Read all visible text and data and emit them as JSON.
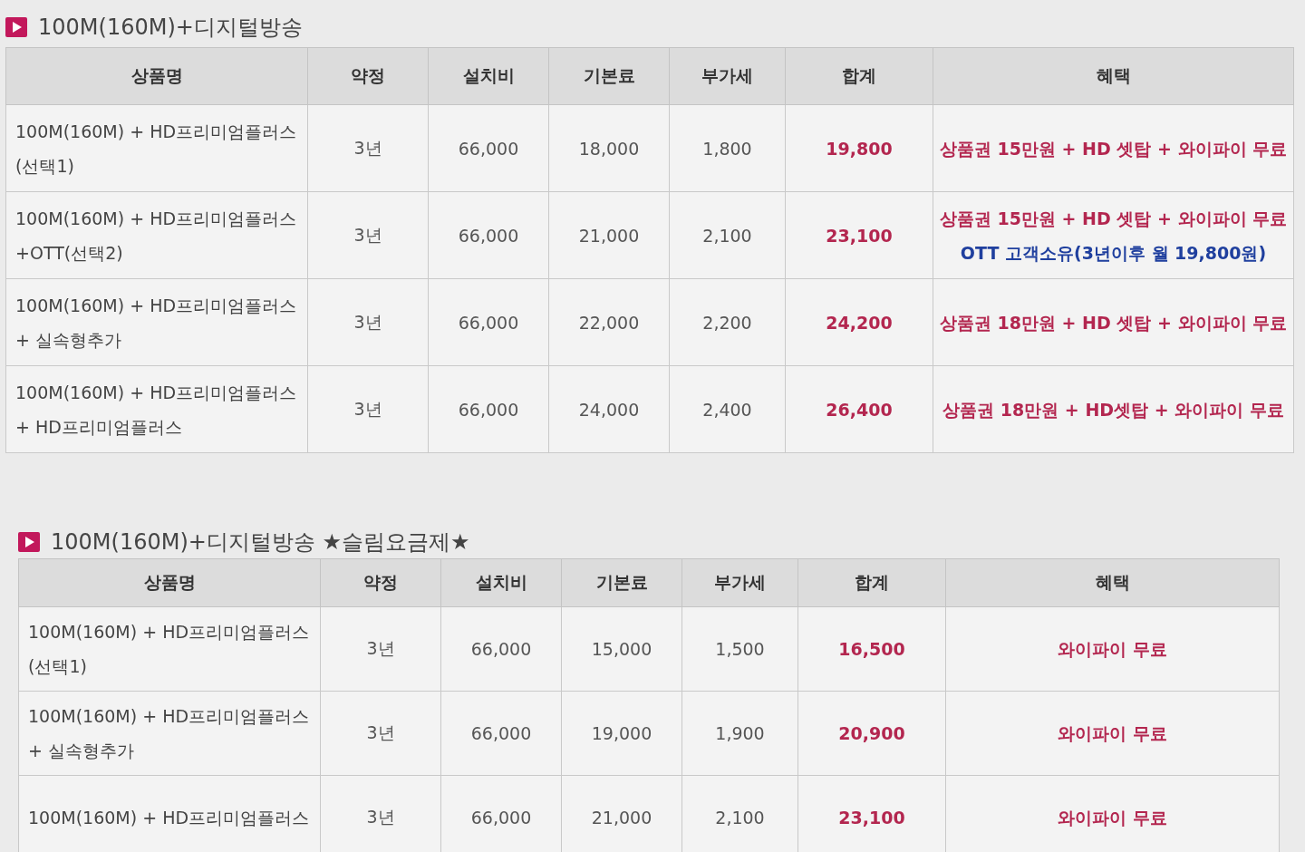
{
  "sections": [
    {
      "title": "100M(160M)+디지털방송",
      "columns": [
        "상품명",
        "약정",
        "설치비",
        "기본료",
        "부가세",
        "합계",
        "혜택"
      ],
      "rows": [
        {
          "name": [
            "100M(160M) + HD프리미엄플러스",
            "(선택1)"
          ],
          "term": "3년",
          "install": "66,000",
          "base": "18,000",
          "vat": "1,800",
          "total": "19,800",
          "benefits": [
            {
              "text": "상품권 15만원 + HD 셋탑 + 와이파이 무료",
              "color": "#b3264f"
            }
          ]
        },
        {
          "name": [
            "100M(160M) + HD프리미엄플러스",
            "+OTT(선택2)"
          ],
          "term": "3년",
          "install": "66,000",
          "base": "21,000",
          "vat": "2,100",
          "total": "23,100",
          "benefits": [
            {
              "text": "상품권 15만원 + HD 셋탑 + 와이파이 무료",
              "color": "#b3264f"
            },
            {
              "text": "OTT 고객소유(3년이후 월 19,800원)",
              "color": "#1f3f9e"
            }
          ]
        },
        {
          "name": [
            "100M(160M) + HD프리미엄플러스",
            "+ 실속형추가"
          ],
          "term": "3년",
          "install": "66,000",
          "base": "22,000",
          "vat": "2,200",
          "total": "24,200",
          "benefits": [
            {
              "text": "상품권 18만원 + HD 셋탑 + 와이파이 무료",
              "color": "#b3264f"
            }
          ]
        },
        {
          "name": [
            "100M(160M) + HD프리미엄플러스",
            "+ HD프리미엄플러스"
          ],
          "term": "3년",
          "install": "66,000",
          "base": "24,000",
          "vat": "2,400",
          "total": "26,400",
          "benefits": [
            {
              "text": "상품권 18만원 + HD셋탑 + 와이파이 무료",
              "color": "#b3264f"
            }
          ]
        }
      ]
    },
    {
      "title": "100M(160M)+디지털방송 ★슬림요금제★",
      "columns": [
        "상품명",
        "약정",
        "설치비",
        "기본료",
        "부가세",
        "합계",
        "혜택"
      ],
      "rows": [
        {
          "name": [
            "100M(160M) + HD프리미엄플러스",
            "(선택1)"
          ],
          "term": "3년",
          "install": "66,000",
          "base": "15,000",
          "vat": "1,500",
          "total": "16,500",
          "benefits": [
            {
              "text": "와이파이 무료",
              "color": "#b3264f"
            }
          ]
        },
        {
          "name": [
            "100M(160M) + HD프리미엄플러스",
            "+ 실속형추가"
          ],
          "term": "3년",
          "install": "66,000",
          "base": "19,000",
          "vat": "1,900",
          "total": "20,900",
          "benefits": [
            {
              "text": "와이파이 무료",
              "color": "#b3264f"
            }
          ]
        },
        {
          "name": [
            "100M(160M) + HD프리미엄플러스"
          ],
          "term": "3년",
          "install": "66,000",
          "base": "21,000",
          "vat": "2,100",
          "total": "23,100",
          "benefits": [
            {
              "text": "와이파이 무료",
              "color": "#b3264f"
            }
          ]
        }
      ]
    }
  ]
}
